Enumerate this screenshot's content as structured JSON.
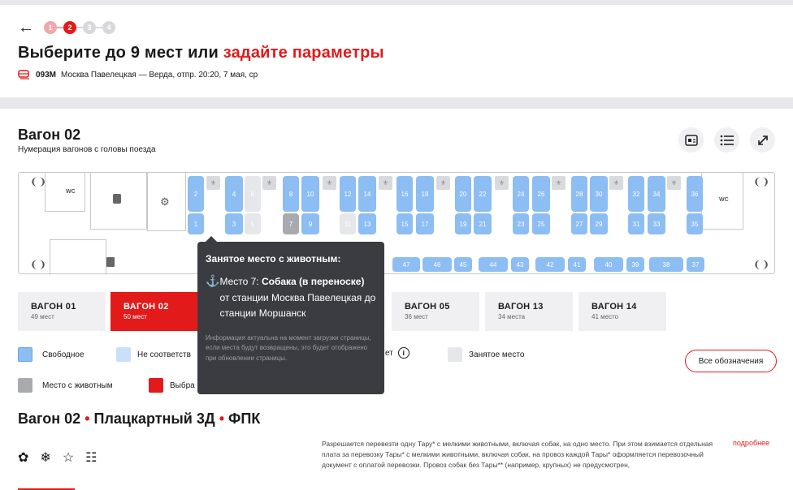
{
  "header": {
    "back_icon": "arrow-left-icon",
    "steps": [
      "1",
      "2",
      "3",
      "4"
    ],
    "title_main": "Выберите до 9 мест или ",
    "title_link": "задайте параметры",
    "route_number": "093М",
    "route_text": "Москва Павелецкая — Верда,  отпр. 20:20, 7 мая, ср"
  },
  "wagon": {
    "title": "Вагон 02",
    "subtitle": "Нумерация вагонов с головы поезда",
    "wc_label": "WC"
  },
  "seats": [
    {
      "n": "2"
    },
    {
      "n": "1"
    },
    {
      "n": "4"
    },
    {
      "n": "3"
    },
    {
      "n": "6"
    },
    {
      "n": "5"
    },
    {
      "n": "8"
    },
    {
      "n": "7"
    },
    {
      "n": "10"
    },
    {
      "n": "9"
    },
    {
      "n": "12"
    },
    {
      "n": "11"
    },
    {
      "n": "14"
    },
    {
      "n": "13"
    },
    {
      "n": "16"
    },
    {
      "n": "15"
    },
    {
      "n": "18"
    },
    {
      "n": "17"
    },
    {
      "n": "20"
    },
    {
      "n": "19"
    },
    {
      "n": "22"
    },
    {
      "n": "21"
    },
    {
      "n": "24"
    },
    {
      "n": "23"
    },
    {
      "n": "26"
    },
    {
      "n": "25"
    },
    {
      "n": "28"
    },
    {
      "n": "27"
    },
    {
      "n": "30"
    },
    {
      "n": "29"
    },
    {
      "n": "32"
    },
    {
      "n": "31"
    },
    {
      "n": "34"
    },
    {
      "n": "33"
    },
    {
      "n": "36"
    },
    {
      "n": "35"
    }
  ],
  "side_seats": [
    "47",
    "46",
    "45",
    "44",
    "43",
    "42",
    "41",
    "40",
    "39",
    "38",
    "37"
  ],
  "tooltip": {
    "title": "Занятое место с животным:",
    "seat_prefix": "Место 7: ",
    "seat_bold": "Собака (в переноске)",
    "route_line": "от станции Москва Павелецкая до станции Моршанск",
    "note": "Информация актуальна на момент загрузки страницы, если места будут возвращены, это будет отображено при обновлении страницы."
  },
  "tabs": [
    {
      "name": "ВАГОН 01",
      "count": "49 мест"
    },
    {
      "name": "ВАГОН 02",
      "count": "50 мест"
    },
    {
      "name": "ВАГОН 05",
      "count": "36 мест"
    },
    {
      "name": "ВАГОН 13",
      "count": "34 места"
    },
    {
      "name": "ВАГОН 14",
      "count": "41 место"
    }
  ],
  "legend": {
    "free": "Свободное",
    "nomatch": "Не соответств",
    "nomatch_tail": "ет",
    "occupied": "Занятое место",
    "pet": "Место с животным",
    "selected": "Выбра",
    "all_button": "Все обозначения"
  },
  "colors": {
    "accent": "#e21a1a",
    "free": "#8cbdf3",
    "nomatch": "#c9e0fa",
    "occupied": "#e6e7ea",
    "pet": "#a9aab0",
    "tooltip_bg": "#3b3c41"
  },
  "section": {
    "w": "Вагон 02",
    "type": "Плацкартный 3Д",
    "carrier": "ФПК",
    "dot": "•",
    "feature_icons": [
      "paw-icon",
      "snowflake-icon",
      "hanger-icon",
      "bed-icon"
    ],
    "rules": "Разрешается перевезти одну Тару* с мелкими животными, включая собак, на одно место. При этом взимается отдельная плата за перевозку Тары* с мелкими животными, включая собак, на провоз каждой Тары* оформляется перевозочный документ с оплатой перевозки. Провоз собак без Тары** (например, крупных) не предусмотрен,",
    "more": "подробнее"
  }
}
